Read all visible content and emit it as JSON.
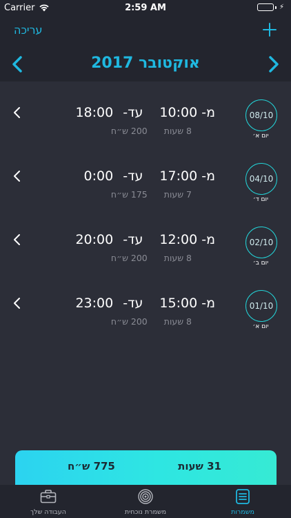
{
  "status_bar": {
    "carrier": "Carrier",
    "time": "2:59 AM"
  },
  "header": {
    "edit_label": "עריכה",
    "add_icon": "plus-icon",
    "month_title": "אוקטובר 2017",
    "prev_icon": "chevron-left-icon",
    "next_icon": "chevron-right-icon",
    "accent_color": "#1fb8e0"
  },
  "shifts": [
    {
      "from_label": "מ-",
      "from_time": "10:00",
      "to_label": "עד-",
      "to_time": "18:00",
      "hours": "8 שעות",
      "pay": "200 ש״ח",
      "date": "08/10",
      "day": "יום א׳"
    },
    {
      "from_label": "מ-",
      "from_time": "17:00",
      "to_label": "עד-",
      "to_time": "0:00",
      "hours": "7 שעות",
      "pay": "175 ש״ח",
      "date": "04/10",
      "day": "יום ד׳"
    },
    {
      "from_label": "מ-",
      "from_time": "12:00",
      "to_label": "עד-",
      "to_time": "20:00",
      "hours": "8 שעות",
      "pay": "200 ש״ח",
      "date": "02/10",
      "day": "יום ב׳"
    },
    {
      "from_label": "מ-",
      "from_time": "15:00",
      "to_label": "עד-",
      "to_time": "23:00",
      "hours": "8 שעות",
      "pay": "200 ש״ח",
      "date": "01/10",
      "day": "יום א׳"
    }
  ],
  "summary": {
    "total_hours": "31 שעות",
    "total_pay": "775 ש״ח"
  },
  "tabs": [
    {
      "label": "העבודה שלך",
      "icon": "briefcase-icon"
    },
    {
      "label": "משמרת נוכחית",
      "icon": "radar-icon"
    },
    {
      "label": "משמרות",
      "icon": "list-icon"
    }
  ]
}
